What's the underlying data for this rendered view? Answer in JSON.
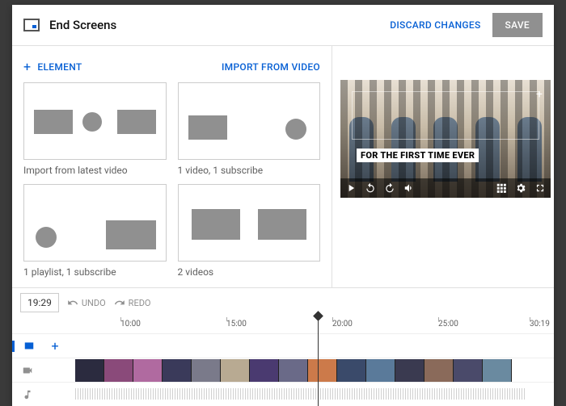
{
  "header": {
    "title": "End Screens",
    "discard": "DISCARD CHANGES",
    "save": "SAVE"
  },
  "leftTop": {
    "addElement": "ELEMENT",
    "import": "IMPORT FROM VIDEO"
  },
  "templates": [
    {
      "label": "Import from latest video"
    },
    {
      "label": "1 video, 1 subscribe"
    },
    {
      "label": "1 playlist, 1 subscribe"
    },
    {
      "label": "2 videos"
    }
  ],
  "preview": {
    "caption": "FOR THE FIRST TIME EVER"
  },
  "timeline": {
    "time": "19:29",
    "undo": "UNDO",
    "redo": "REDO",
    "ticks": [
      "10:00",
      "15:00",
      "20:00",
      "25:00",
      "30:19"
    ]
  },
  "colors": {
    "accent": "#065fd4"
  }
}
